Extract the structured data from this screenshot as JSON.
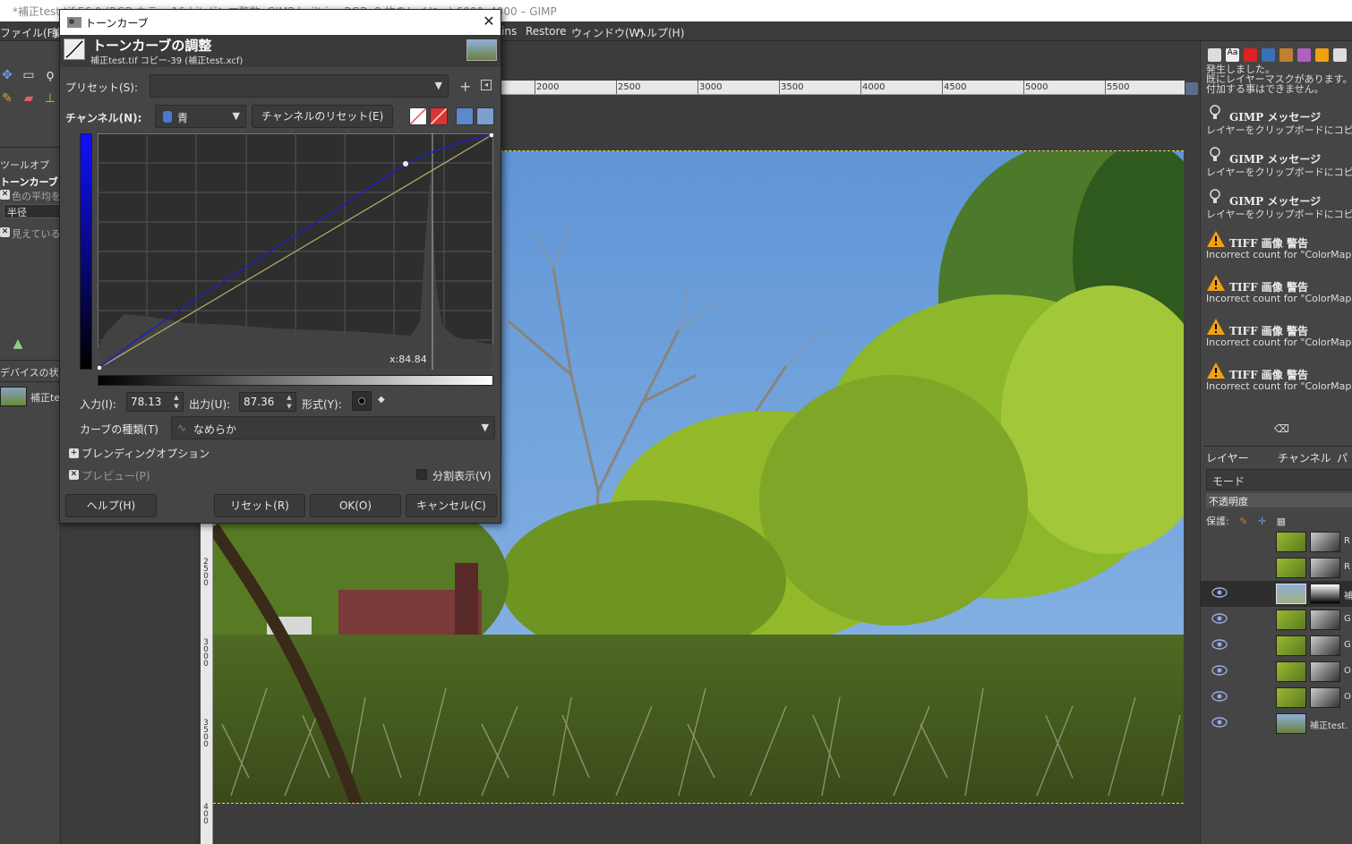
{
  "window_title": "*補正test.tif-56.0 (RGB カラー 16-bit ガンマ整数, GIMP built-in sRGB, 8 枚のレイヤー) 6000x4000 – GIMP",
  "menubar": [
    "ファイル(F)",
    "編",
    "ins",
    "Restore",
    "ウィンドウ(W)",
    "ヘルプ(H)"
  ],
  "toolbox": {
    "tool_options_tab": "ツールオプ",
    "tool_name": "トーンカーブ",
    "sample_average": "色の平均を",
    "radius_label": "半径",
    "visible_label": "見えている",
    "device_status_tab": "デバイスの状",
    "image_name": "補正test"
  },
  "ruler": {
    "h_ticks": [
      "2000",
      "2500",
      "3000",
      "3500",
      "4000",
      "4500",
      "5000",
      "5500"
    ],
    "v_ticks": [
      "2\n5\n0\n0",
      "3\n0\n0\n0",
      "3\n5\n0\n0",
      "4\n0\n0"
    ]
  },
  "dialog": {
    "title": "トーンカーブ",
    "close": "✕",
    "heading": "トーンカーブの調整",
    "subheading": "補正test.tif コピー-39 (補正test.xcf)",
    "preset_label": "プリセット(S):",
    "preset_value": "",
    "channel_label": "チャンネル(N):",
    "channel_value": "青",
    "channel_reset": "チャンネルのリセット(E)",
    "x_readout": "x:84.84",
    "input_label": "入力(I):",
    "input_value": "78.13",
    "output_label": "出力(U):",
    "output_value": "87.36",
    "type_label": "形式(Y):",
    "curve_type_label": "カーブの種類(T)",
    "curve_type_value": "なめらか",
    "blending_options": "ブレンディングオプション",
    "preview_label": "プレビュー(P)",
    "split_view_label": "分割表示(V)",
    "buttons": {
      "help": "ヘルプ(H)",
      "reset": "リセット(R)",
      "ok": "OK(O)",
      "cancel": "キャンセル(C)"
    },
    "curve": {
      "channel_color": "#1a1aa8",
      "points": [
        [
          0,
          0
        ],
        [
          78.13,
          87.36
        ],
        [
          100,
          100
        ]
      ]
    }
  },
  "right_panel": {
    "message_top": "発生しました。\n既にレイヤーマスクがあります。\n付加する事はできません。",
    "messages": [
      {
        "icon": "info-bulb-icon",
        "title": "GIMP メッセージ",
        "body": "レイヤーをクリップボードにコピ"
      },
      {
        "icon": "info-bulb-icon",
        "title": "GIMP メッセージ",
        "body": "レイヤーをクリップボードにコピ"
      },
      {
        "icon": "info-bulb-icon",
        "title": "GIMP メッセージ",
        "body": "レイヤーをクリップボードにコピ"
      },
      {
        "icon": "warning-icon",
        "title": "TIFF 画像 警告",
        "body": "Incorrect count for \"ColorMap\"; ta"
      },
      {
        "icon": "warning-icon",
        "title": "TIFF 画像 警告",
        "body": "Incorrect count for \"ColorMap\"; ta"
      },
      {
        "icon": "warning-icon",
        "title": "TIFF 画像 警告",
        "body": "Incorrect count for \"ColorMap\"; ta"
      },
      {
        "icon": "warning-icon",
        "title": "TIFF 画像 警告",
        "body": "Incorrect count for \"ColorMap\"; ta"
      }
    ],
    "tabs": [
      "レイヤー",
      "チャンネル",
      "パ"
    ],
    "mode_label": "モード",
    "opacity_label": "不透明度",
    "protect_label": "保護:",
    "layers": [
      {
        "name": "R",
        "visible": false,
        "type": "green"
      },
      {
        "name": "R",
        "visible": false,
        "type": "green"
      },
      {
        "name": "補",
        "visible": true,
        "type": "sky"
      },
      {
        "name": "G",
        "visible": true,
        "type": "green"
      },
      {
        "name": "G",
        "visible": true,
        "type": "green"
      },
      {
        "name": "O",
        "visible": true,
        "type": "green"
      },
      {
        "name": "O",
        "visible": true,
        "type": "green"
      },
      {
        "name": "補正test.",
        "visible": true,
        "type": "photo"
      }
    ]
  }
}
